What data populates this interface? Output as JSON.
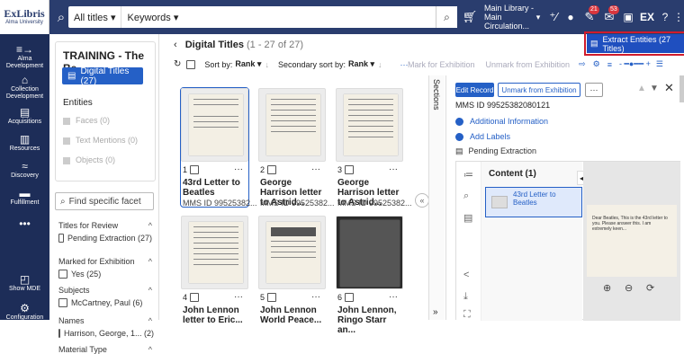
{
  "topbar": {
    "logo_line1": "ExLibris",
    "logo_line2": "Alma University",
    "search_scope": "All titles ▾",
    "search_field": "Keywords ▾",
    "library": "Main Library - Main Circulation...",
    "library_caret": "▾",
    "badge_tasks": "21",
    "badge_notify": "53",
    "ex_label": "EX"
  },
  "sidebar": [
    {
      "label": "Alma Development",
      "icon": "≡→"
    },
    {
      "label": "Collection Development",
      "icon": "🏛"
    },
    {
      "label": "Acquisitions",
      "icon": "▤"
    },
    {
      "label": "Resources",
      "icon": "⌂"
    },
    {
      "label": "Discovery",
      "icon": "≈"
    },
    {
      "label": "Fulfillment",
      "icon": "▬"
    },
    {
      "label": "",
      "icon": "•••"
    },
    {
      "label": "Show MDE",
      "icon": "◰"
    },
    {
      "label": "Configuration",
      "icon": "⚙"
    }
  ],
  "facets": {
    "title": "TRAINING - The Be..",
    "digital_titles": "Digital Titles (27)",
    "entities_header": "Entities",
    "entities": [
      "Faces (0)",
      "Text Mentions (0)",
      "Objects (0)"
    ],
    "find_placeholder": "Find specific facet",
    "groups": [
      {
        "header": "Titles for Review",
        "options": [
          "Pending Extraction (27)"
        ]
      },
      {
        "header": "Marked for Exhibition",
        "options": [
          "Yes (25)"
        ]
      },
      {
        "header": "Subjects",
        "options": [
          "McCartney, Paul (6)"
        ]
      },
      {
        "header": "Names",
        "options": [
          "Harrison, George, 1...  (2)"
        ]
      },
      {
        "header": "Material Type",
        "options": []
      }
    ]
  },
  "main": {
    "title": "Digital Titles",
    "count": "(1 - 27 of 27)",
    "sort_by_label": "Sort by:",
    "sort_by_value": "Rank ▾",
    "secondary_label": "Secondary sort by:",
    "secondary_value": "Rank ▾",
    "mark_exhibition": "Mark for Exhibition",
    "unmark_exhibition": "Unmark from Exhibition",
    "extract_button": "Extract Entities (27 Titles)",
    "cards": [
      {
        "num": "1",
        "title": "43rd Letter to Beatles",
        "mms": "MMS ID 99525382..."
      },
      {
        "num": "2",
        "title": "George Harrison letter to Astrid...",
        "mms": "MMS ID 99525382..."
      },
      {
        "num": "3",
        "title": "George Harrison letter to Astrid...",
        "mms": "MMS ID 99525382..."
      },
      {
        "num": "4",
        "title": "John Lennon letter to Eric...",
        "mms": ""
      },
      {
        "num": "5",
        "title": "John Lennon World Peace...",
        "mms": ""
      },
      {
        "num": "6",
        "title": "John Lennon, Ringo Starr an...",
        "mms": ""
      }
    ]
  },
  "sections_label": "Sections",
  "panel": {
    "edit": "Edit Record",
    "unlink": "Unmark from Exhibition",
    "more": "···",
    "mms_id": "MMS ID 99525382080121",
    "additional": "Additional Information",
    "add_labels": "Add Labels",
    "pending": "Pending Extraction",
    "content_header": "Content (1)",
    "content_item": "43rd Letter to Beatles",
    "preview_text": "Dear Beatles, This is the 43rd letter to you. Please answer this. I am extremely keen..."
  },
  "colors": {
    "navy": "#2a3d6e",
    "sidebar": "#1d2d58",
    "accent": "#2560c6",
    "highlight": "#d01c2c"
  }
}
